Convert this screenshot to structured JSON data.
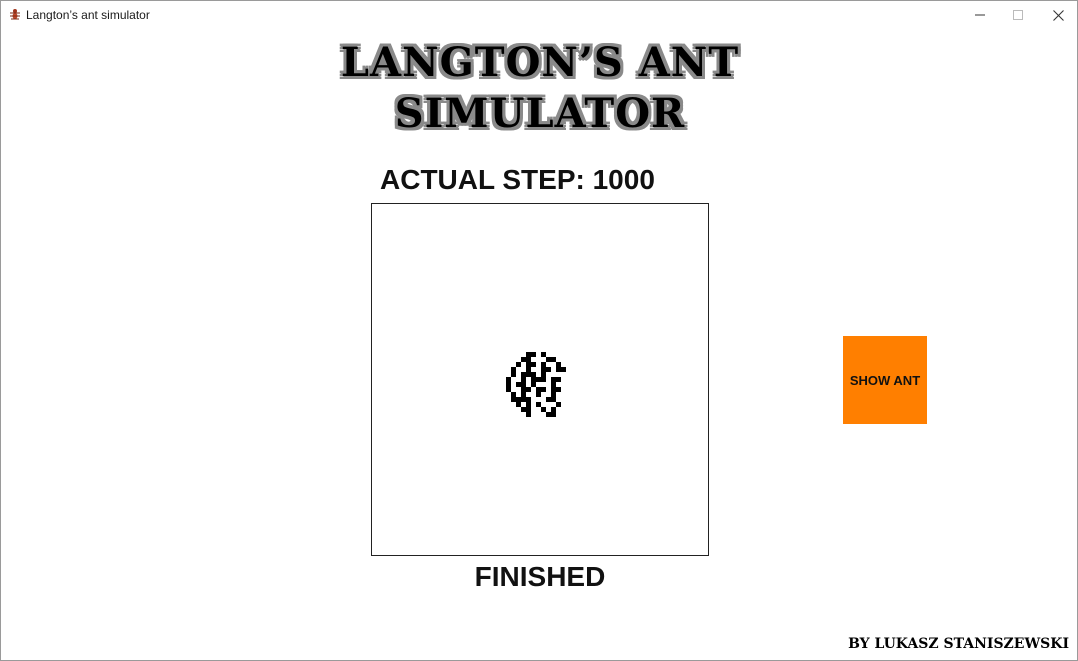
{
  "window": {
    "title": "Langton’s ant simulator",
    "app_icon": "ant-icon",
    "controls": [
      "minimize-icon",
      "maximize-icon",
      "close-icon"
    ]
  },
  "header": {
    "title_line1": "LANGTON’S ANT",
    "title_line2": "SIMULATOR"
  },
  "status": {
    "step_label": "ACTUAL STEP:",
    "step_value": "1000",
    "state_text": "FINISHED"
  },
  "grid": {
    "cell_color": "#000000",
    "background": "#ffffff",
    "pattern_rows": [
      "....##.#....",
      "...##...##..",
      "..#.##.#..#.",
      ".#..#..##.##",
      ".#.###.#....",
      "#..#.###.##.",
      "#.##.#...#..",
      "#..##.##.##.",
      ".#.#..#..#..",
      ".####...##..",
      "..#.#.#...#.",
      "...##..#.#..",
      "....#...##.."
    ]
  },
  "controls": {
    "show_ant_label": "SHOW ANT",
    "show_ant_color": "#ff7f00"
  },
  "footer": {
    "author": "BY LUKASZ STANISZEWSKI"
  }
}
